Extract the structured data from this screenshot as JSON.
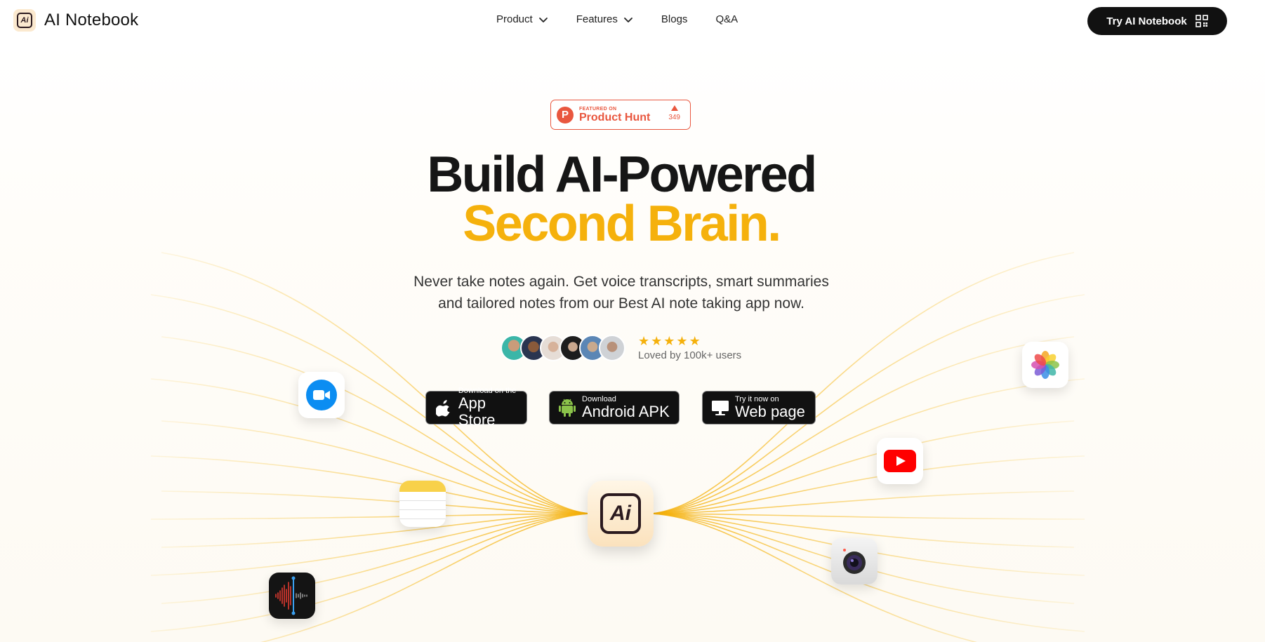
{
  "nav": {
    "brand": "AI Notebook",
    "links": [
      {
        "label": "Product",
        "dropdown": true
      },
      {
        "label": "Features",
        "dropdown": true
      },
      {
        "label": "Blogs",
        "dropdown": false
      },
      {
        "label": "Q&A",
        "dropdown": false
      }
    ],
    "cta_label": "Try AI Notebook",
    "cta_icon": "qr-code-icon"
  },
  "badge": {
    "small": "FEATURED ON",
    "big": "Product Hunt",
    "votes": "349",
    "color": "#e9573f"
  },
  "hero": {
    "title_line1": "Build AI-Powered",
    "title_line2": "Second Brain.",
    "subtitle_line1": "Never take notes again. Get voice transcripts, smart summaries",
    "subtitle_line2": "and tailored notes from our Best AI note taking app now.",
    "accent_color": "#f5b10c"
  },
  "social": {
    "avatar_count": 7,
    "stars": 5,
    "loved_text": "Loved by 100k+ users"
  },
  "stores": [
    {
      "small": "Download on the",
      "big": "App Store",
      "icon": "apple-icon"
    },
    {
      "small": "Download",
      "big": "Android APK",
      "icon": "android-icon"
    },
    {
      "small": "Try it now on",
      "big": "Web page",
      "icon": "monitor-icon"
    }
  ],
  "apps": [
    "zoom-icon",
    "notes-icon",
    "voice-memos-icon",
    "ai-notebook-icon",
    "youtube-icon",
    "camera-icon",
    "photos-icon"
  ]
}
